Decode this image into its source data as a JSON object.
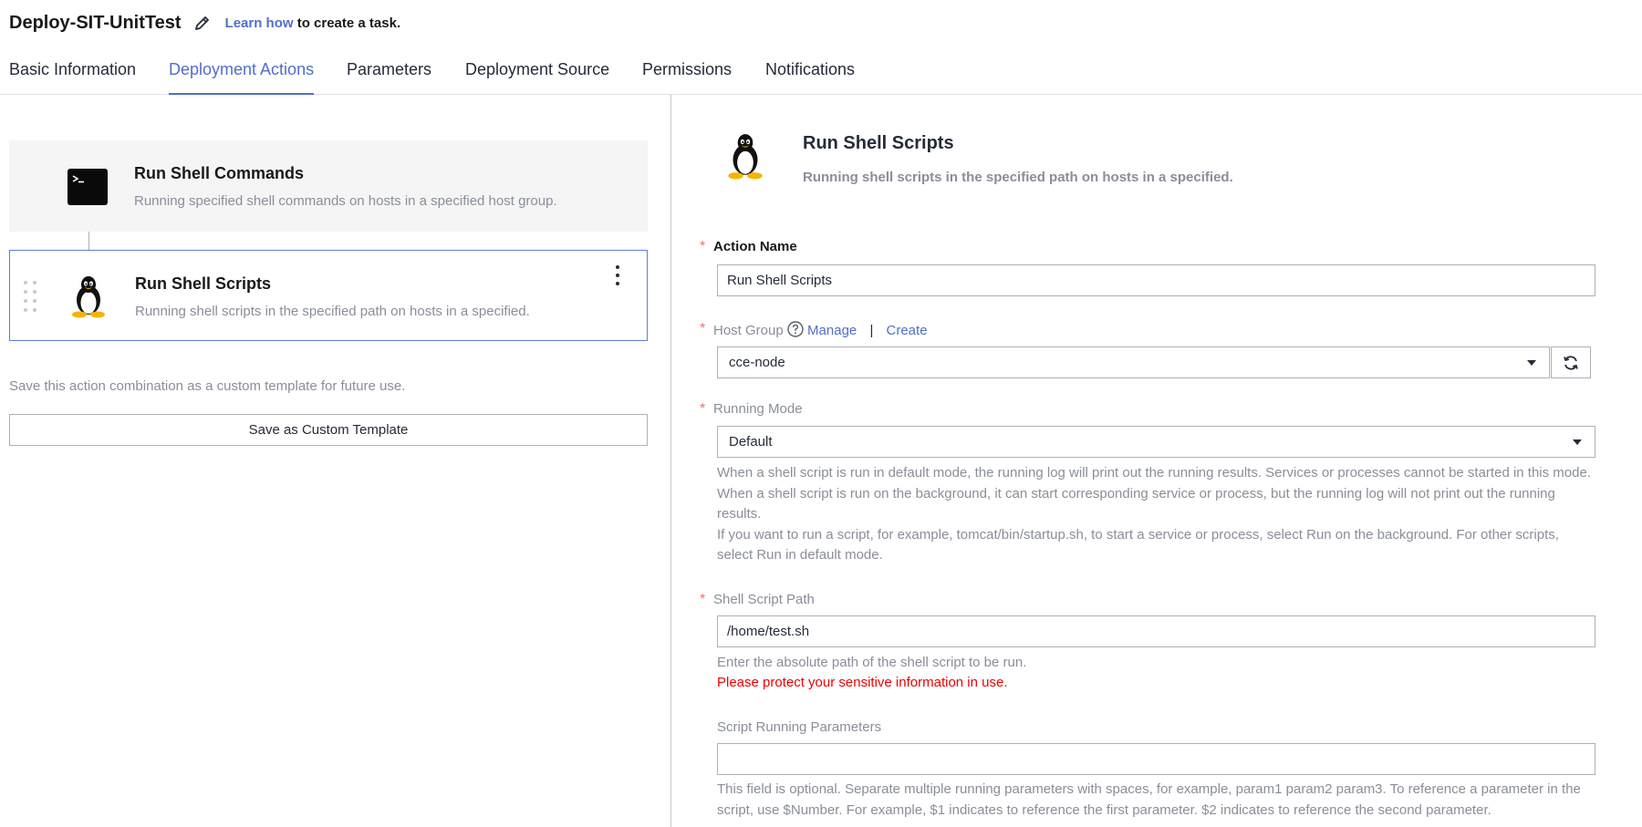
{
  "header": {
    "task_name": "Deploy-SIT-UnitTest",
    "learn_link": "Learn how",
    "learn_rest": " to create a task."
  },
  "tabs": [
    {
      "label": "Basic Information",
      "active": false
    },
    {
      "label": "Deployment Actions",
      "active": true
    },
    {
      "label": "Parameters",
      "active": false
    },
    {
      "label": "Deployment Source",
      "active": false
    },
    {
      "label": "Permissions",
      "active": false
    },
    {
      "label": "Notifications",
      "active": false
    }
  ],
  "actions": [
    {
      "title": "Run Shell Commands",
      "description": "Running specified shell commands on hosts in a specified host group.",
      "icon": "terminal-icon"
    },
    {
      "title": "Run Shell Scripts",
      "description": "Running shell scripts in the specified path on hosts in a specified.",
      "icon": "linux-penguin-icon"
    }
  ],
  "save": {
    "hint": "Save this action combination as a custom template for future use.",
    "button_label": "Save as Custom Template"
  },
  "detail": {
    "title": "Run Shell Scripts",
    "description": "Running shell scripts in the specified path on hosts in a specified.",
    "action_name": {
      "label": "Action Name",
      "value": "Run Shell Scripts"
    },
    "host_group": {
      "label": "Host Group",
      "manage": "Manage",
      "separator": "|",
      "create": "Create",
      "value": "cce-node"
    },
    "running_mode": {
      "label": "Running Mode",
      "value": "Default",
      "help_1": "When a shell script is run in default mode, the running log will print out the running results. Services or processes cannot be started in this mode.",
      "help_2": "When a shell script is run on the background, it can start corresponding service or process, but the running log will not print out the running results.",
      "help_3": "If you want to run a script, for example, tomcat/bin/startup.sh, to start a service or process, select Run on the background. For other scripts, select Run in default mode."
    },
    "script_path": {
      "label": "Shell Script Path",
      "value": "/home/test.sh",
      "help": "Enter the absolute path of the shell script to be run.",
      "warning": "Please protect your sensitive information in use."
    },
    "script_params": {
      "label": "Script Running Parameters",
      "value": "",
      "help": "This field is optional. Separate multiple running parameters with spaces, for example, param1 param2 param3. To reference a parameter in the script, use $Number. For example, $1 indicates to reference the first parameter. $2 indicates to reference the second parameter."
    },
    "required_mark": "*"
  },
  "colors": {
    "accent": "#526ecc",
    "required": "#f66f6a",
    "warning": "#f00000",
    "muted": "#8a8e99"
  }
}
